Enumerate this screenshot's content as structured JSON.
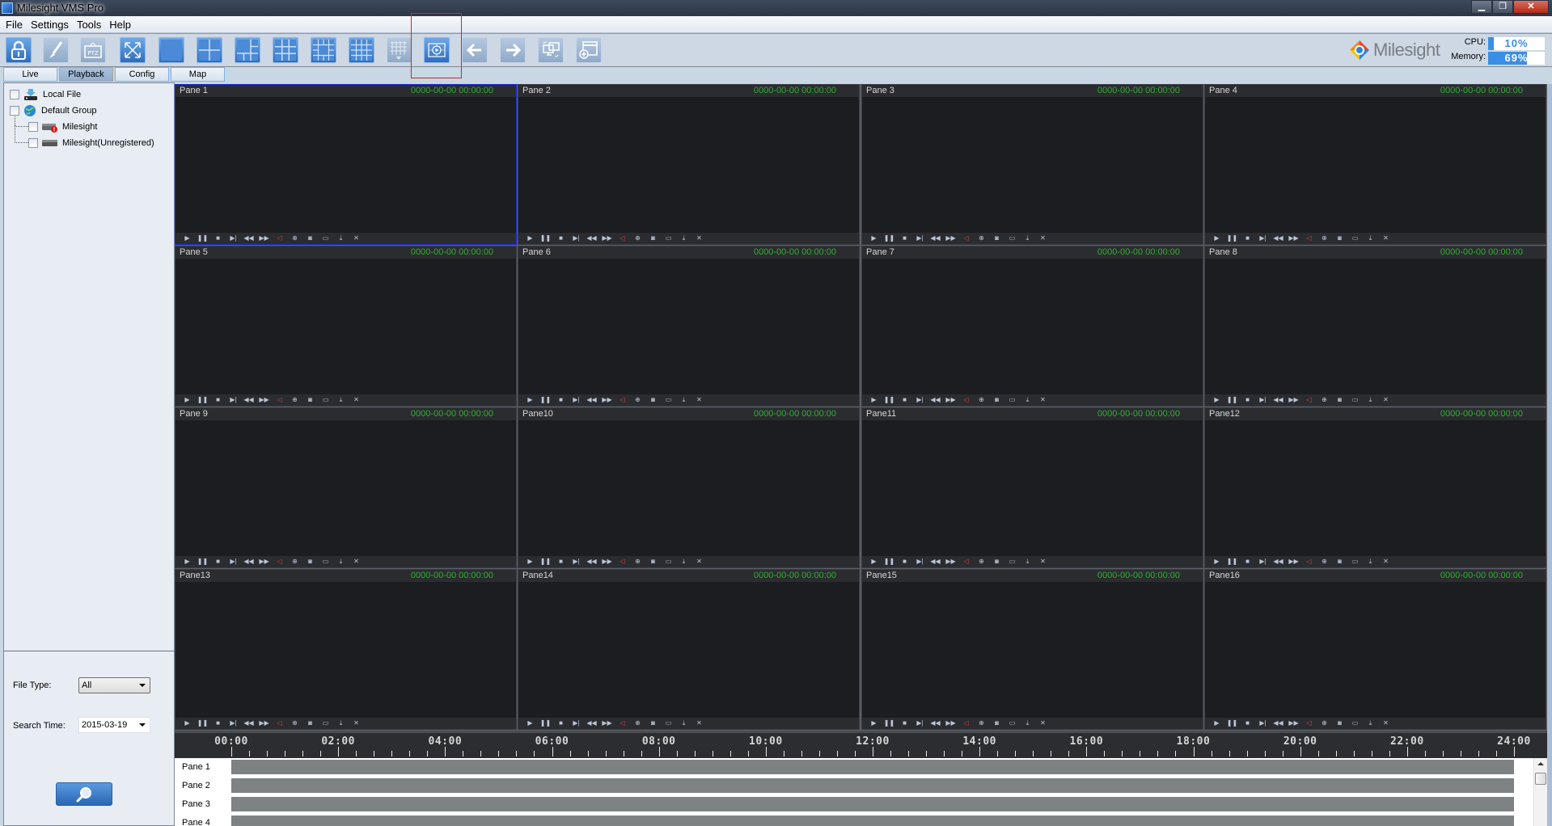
{
  "window": {
    "title": "Milesight VMS Pro",
    "controls": [
      "minimize",
      "restore",
      "close"
    ]
  },
  "menu": [
    {
      "label": "File",
      "mnemonic": "F"
    },
    {
      "label": "Settings",
      "mnemonic": "S"
    },
    {
      "label": "Tools",
      "mnemonic": "T"
    },
    {
      "label": "Help",
      "mnemonic": "H"
    }
  ],
  "toolbar": {
    "buttons": [
      {
        "name": "lock",
        "icon": "lock-icon",
        "enabled": true
      },
      {
        "name": "brush",
        "icon": "brush-icon",
        "enabled": false
      },
      {
        "name": "ptz",
        "icon": "ptz-icon",
        "enabled": false
      },
      {
        "name": "fullscreen",
        "icon": "fullscreen-icon",
        "enabled": true
      },
      {
        "name": "layout-1",
        "icon": "layout-1-icon",
        "enabled": true
      },
      {
        "name": "layout-4",
        "icon": "layout-4-icon",
        "enabled": true
      },
      {
        "name": "layout-6",
        "icon": "layout-6-icon",
        "enabled": true
      },
      {
        "name": "layout-9",
        "icon": "layout-9-icon",
        "enabled": true
      },
      {
        "name": "layout-13",
        "icon": "layout-13-icon",
        "enabled": true
      },
      {
        "name": "layout-16",
        "icon": "layout-16-icon",
        "enabled": true
      },
      {
        "name": "layout-more",
        "icon": "layout-more-icon",
        "enabled": false
      },
      {
        "name": "playback-sync",
        "icon": "playback-sync-icon",
        "enabled": true
      },
      {
        "name": "previous-page",
        "icon": "arrow-left-icon",
        "enabled": false
      },
      {
        "name": "next-page",
        "icon": "arrow-right-icon",
        "enabled": false
      },
      {
        "name": "switch-monitor",
        "icon": "monitor-switch-icon",
        "enabled": false
      },
      {
        "name": "add-window",
        "icon": "add-window-icon",
        "enabled": false
      }
    ],
    "highlighted_button": "playback-sync"
  },
  "brand": {
    "logo_text": "Milesight"
  },
  "system": {
    "cpu_label": "CPU:",
    "cpu_value": "10%",
    "cpu_percent": 10,
    "memory_label": "Memory:",
    "memory_value": "69%",
    "memory_percent": 69
  },
  "tabs": [
    {
      "label": "Live",
      "active": false
    },
    {
      "label": "Playback",
      "active": true
    },
    {
      "label": "Config",
      "active": false
    },
    {
      "label": "Map",
      "active": false
    }
  ],
  "tree": [
    {
      "label": "Local File",
      "icon": "local-file-icon",
      "level": 0,
      "checked": false
    },
    {
      "label": "Default Group",
      "icon": "globe-icon",
      "level": 0,
      "checked": false
    },
    {
      "label": "Milesight",
      "icon": "nvr-alert-icon",
      "level": 1,
      "checked": false
    },
    {
      "label": "Milesight(Unregistered)",
      "icon": "nvr-icon",
      "level": 1,
      "checked": false
    }
  ],
  "search": {
    "file_type_label": "File Type:",
    "file_type_value": "All",
    "search_time_label": "Search Time:",
    "search_time_value": "2015-03-19",
    "search_button_icon": "search-icon"
  },
  "panes": [
    {
      "name": "Pane 1",
      "time": "0000-00-00 00:00:00",
      "selected": true
    },
    {
      "name": "Pane 2",
      "time": "0000-00-00 00:00:00"
    },
    {
      "name": "Pane 3",
      "time": "0000-00-00 00:00:00"
    },
    {
      "name": "Pane 4",
      "time": "0000-00-00 00:00:00"
    },
    {
      "name": "Pane 5",
      "time": "0000-00-00 00:00:00"
    },
    {
      "name": "Pane 6",
      "time": "0000-00-00 00:00:00"
    },
    {
      "name": "Pane 7",
      "time": "0000-00-00 00:00:00"
    },
    {
      "name": "Pane 8",
      "time": "0000-00-00 00:00:00"
    },
    {
      "name": "Pane 9",
      "time": "0000-00-00 00:00:00"
    },
    {
      "name": "Pane10",
      "time": "0000-00-00 00:00:00"
    },
    {
      "name": "Pane11",
      "time": "0000-00-00 00:00:00"
    },
    {
      "name": "Pane12",
      "time": "0000-00-00 00:00:00"
    },
    {
      "name": "Pane13",
      "time": "0000-00-00 00:00:00"
    },
    {
      "name": "Pane14",
      "time": "0000-00-00 00:00:00"
    },
    {
      "name": "Pane15",
      "time": "0000-00-00 00:00:00"
    },
    {
      "name": "Pane16",
      "time": "0000-00-00 00:00:00"
    }
  ],
  "pane_controls": [
    {
      "name": "play",
      "glyph": "▶",
      "icon": "play-icon"
    },
    {
      "name": "pause",
      "glyph": "❚❚",
      "icon": "pause-icon"
    },
    {
      "name": "stop",
      "glyph": "■",
      "icon": "stop-icon"
    },
    {
      "name": "step",
      "glyph": "▶|",
      "icon": "step-forward-icon"
    },
    {
      "name": "slow",
      "glyph": "◀◀",
      "icon": "rewind-icon"
    },
    {
      "name": "fast",
      "glyph": "▶▶",
      "icon": "fast-forward-icon"
    },
    {
      "name": "audio",
      "glyph": "◁",
      "icon": "audio-muted-icon",
      "red": true
    },
    {
      "name": "zoom",
      "glyph": "⊕",
      "icon": "digital-zoom-icon"
    },
    {
      "name": "snapshot",
      "glyph": "◙",
      "icon": "snapshot-icon"
    },
    {
      "name": "record",
      "glyph": "▭",
      "icon": "record-icon"
    },
    {
      "name": "download",
      "glyph": "⤓",
      "icon": "download-icon"
    },
    {
      "name": "close",
      "glyph": "✕",
      "icon": "close-pane-icon"
    }
  ],
  "timeline": {
    "labels": [
      "00:00",
      "02:00",
      "04:00",
      "06:00",
      "08:00",
      "10:00",
      "12:00",
      "14:00",
      "16:00",
      "18:00",
      "20:00",
      "22:00",
      "24:00"
    ],
    "tracks": [
      {
        "label": "Pane 1"
      },
      {
        "label": "Pane 2"
      },
      {
        "label": "Pane 3"
      },
      {
        "label": "Pane 4"
      }
    ]
  }
}
